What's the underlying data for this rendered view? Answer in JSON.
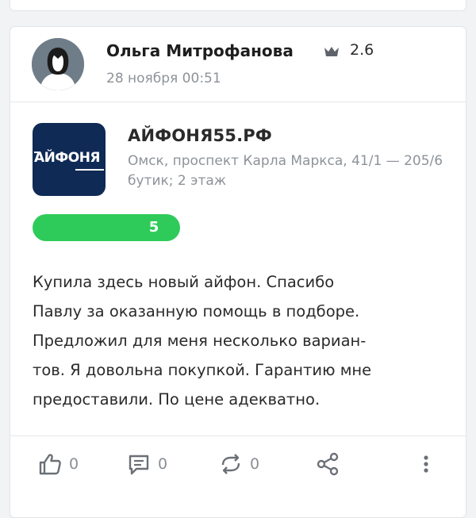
{
  "review": {
    "author_name": "Ольга Митрофанова",
    "author_rating": "2.6",
    "date": "28 ноября 00:51",
    "company": {
      "logo_text": "АЙФОНЯ",
      "name": "АЙФОНЯ55.РФ",
      "address": "Омск, проспект Карла Маркса, 41/1 — 205/6 бутик; 2 этаж"
    },
    "score": "5",
    "text_lines": [
      "Купила здесь новый айфон. Спасибо",
      "Павлу за оказанную помощь в подборе.",
      "Предложил для меня несколько вариан-",
      "тов. Я довольна покупкой. Гарантию мне",
      "предоставили. По цене адекватно."
    ],
    "actions": {
      "likes": "0",
      "comments": "0",
      "reposts": "0"
    }
  },
  "icons": {
    "crown": "crown-icon",
    "like": "thumbs-up-icon",
    "comment": "comment-icon",
    "repost": "repost-icon",
    "share": "share-icon",
    "more": "more-vertical-icon"
  },
  "colors": {
    "score_bar": "#2fcb5a",
    "logo_bg": "#0f2a55",
    "muted_text": "#8e9399"
  }
}
